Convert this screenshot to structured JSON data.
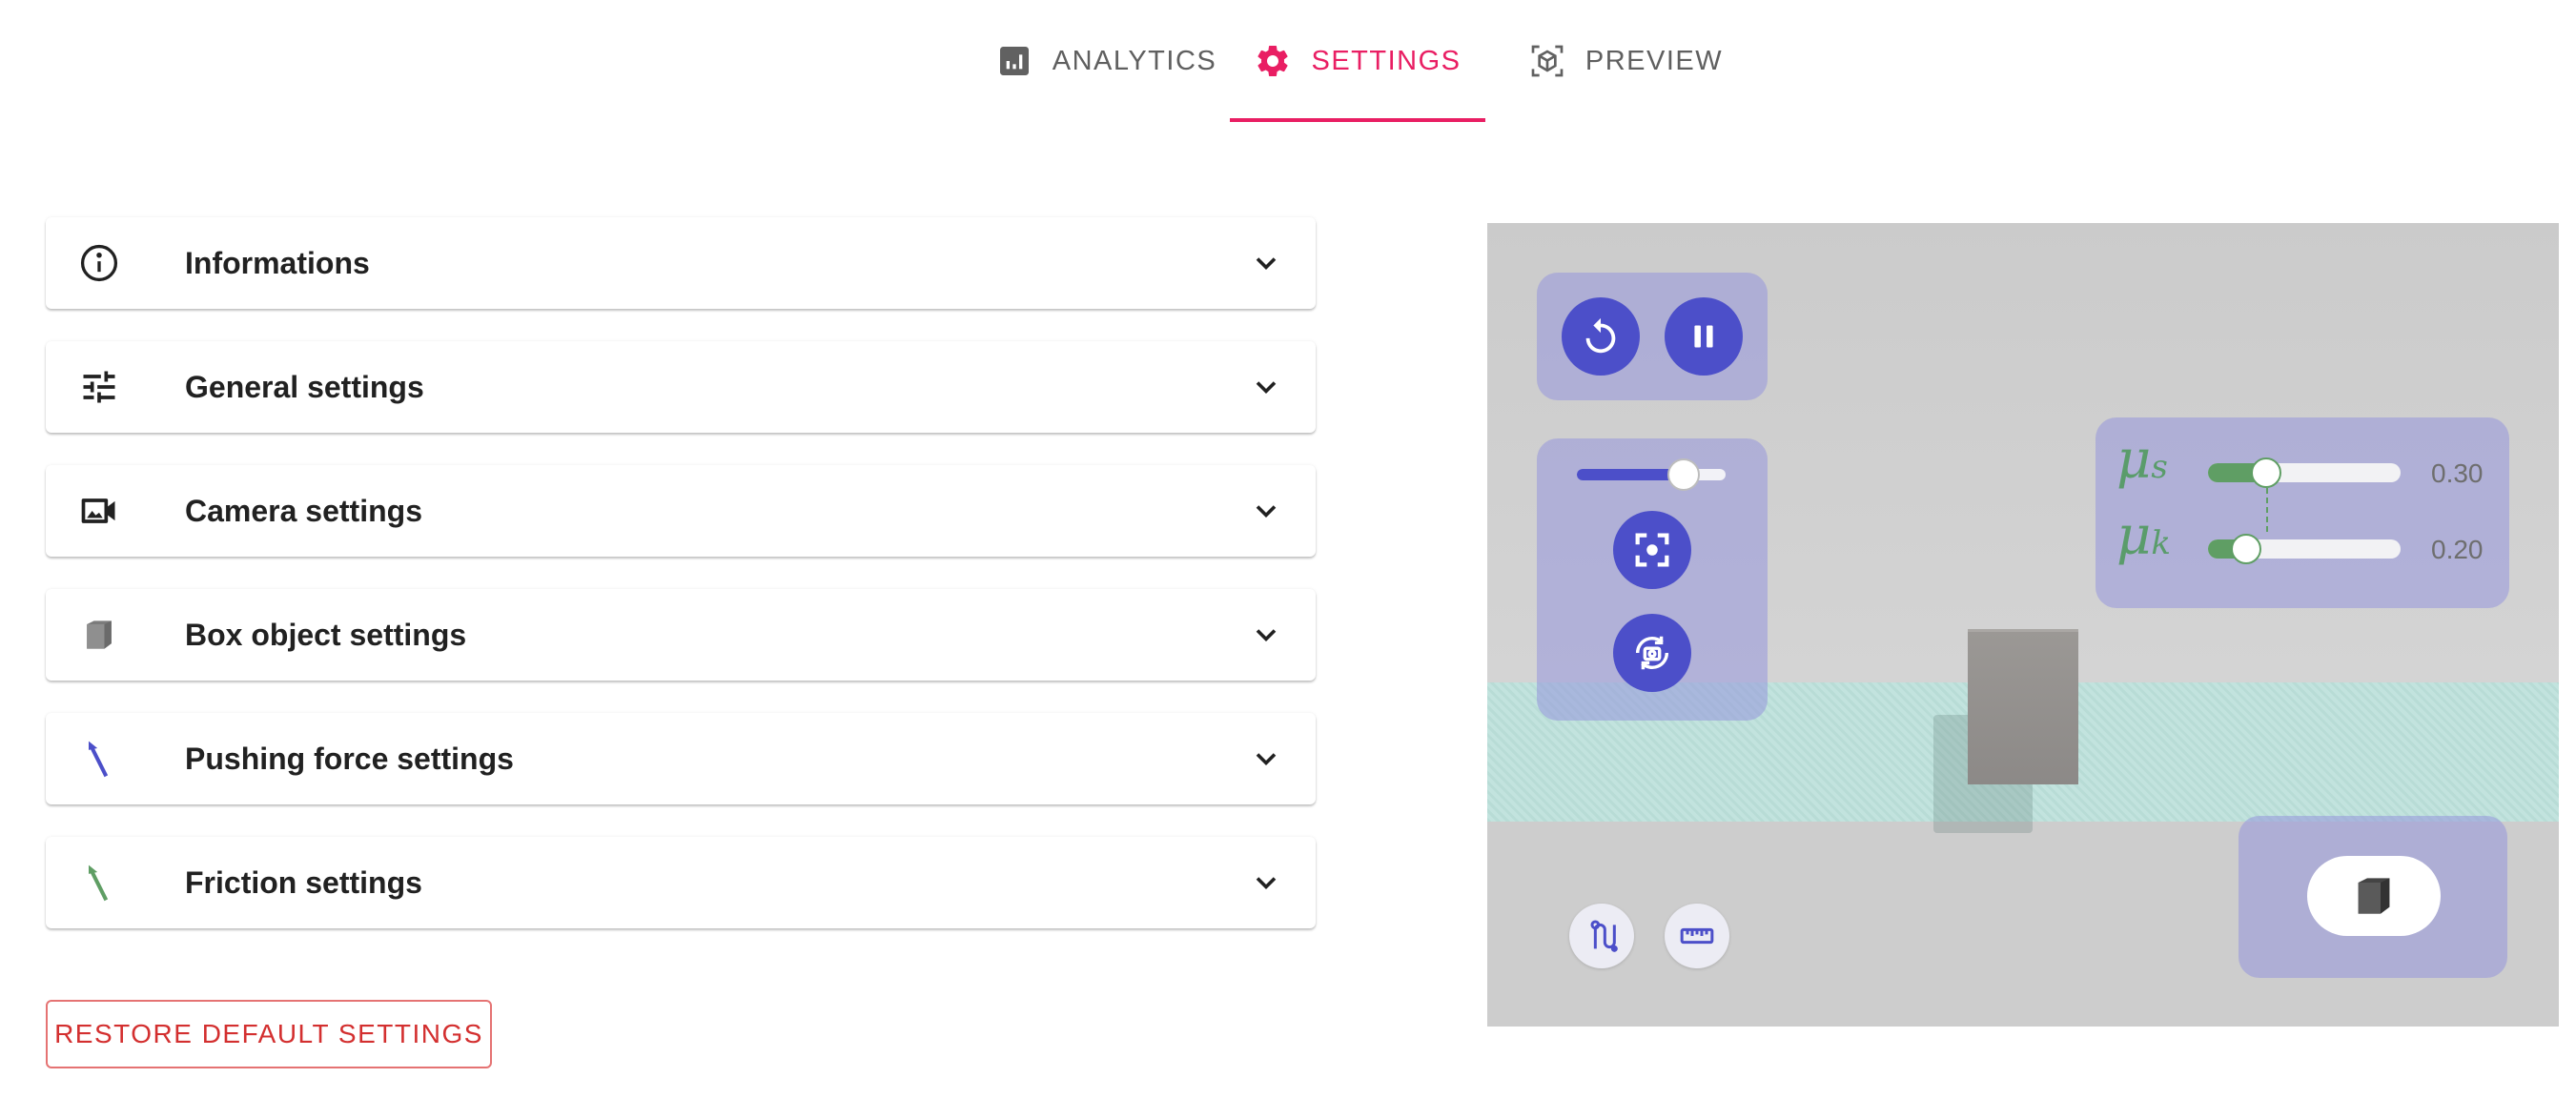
{
  "tabs": [
    {
      "label": "ANALYTICS",
      "icon": "analytics-icon"
    },
    {
      "label": "SETTINGS",
      "icon": "gear-icon",
      "active": true
    },
    {
      "label": "PREVIEW",
      "icon": "cube-preview-icon"
    }
  ],
  "panels": [
    {
      "label": "Informations",
      "icon": "info-icon"
    },
    {
      "label": "General settings",
      "icon": "tune-icon"
    },
    {
      "label": "Camera settings",
      "icon": "camera-icon"
    },
    {
      "label": "Box object settings",
      "icon": "box-icon"
    },
    {
      "label": "Pushing force settings",
      "icon": "force-arrow-icon"
    },
    {
      "label": "Friction settings",
      "icon": "friction-arrow-icon"
    }
  ],
  "restore_label": "RESTORE DEFAULT SETTINGS",
  "sim": {
    "zoom_level": 0.72,
    "mu_s": {
      "value": 0.3,
      "label": "0.30"
    },
    "mu_k": {
      "value": 0.2,
      "label": "0.20"
    }
  },
  "colors": {
    "accent": "#e91e63",
    "sim_button": "#4c4fc9",
    "friction": "#5f9e64",
    "restore": "#d32f2f"
  }
}
